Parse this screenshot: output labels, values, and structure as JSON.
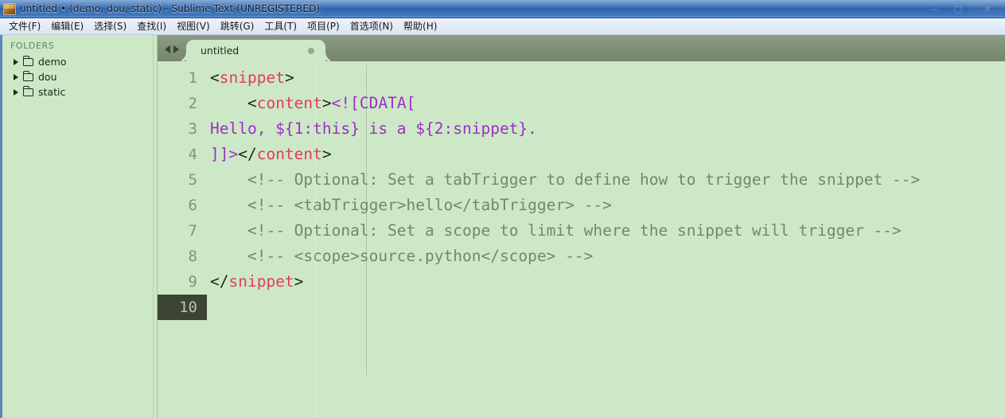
{
  "window": {
    "title": "untitled • (demo, dou, static) - Sublime Text (UNREGISTERED)",
    "icon": "sublime-text-icon",
    "controls": {
      "minimize": "—",
      "maximize": "▢",
      "close": "✕"
    }
  },
  "menubar": {
    "items": [
      {
        "label": "文件(F)",
        "text": "文件",
        "mnemonic": "F"
      },
      {
        "label": "编辑(E)",
        "text": "编辑",
        "mnemonic": "E"
      },
      {
        "label": "选择(S)",
        "text": "选择",
        "mnemonic": "S"
      },
      {
        "label": "查找(I)",
        "text": "查找",
        "mnemonic": "I"
      },
      {
        "label": "视图(V)",
        "text": "视图",
        "mnemonic": "V"
      },
      {
        "label": "跳转(G)",
        "text": "跳转",
        "mnemonic": "G"
      },
      {
        "label": "工具(T)",
        "text": "工具",
        "mnemonic": "T"
      },
      {
        "label": "项目(P)",
        "text": "项目",
        "mnemonic": "P"
      },
      {
        "label": "首选项(N)",
        "text": "首选项",
        "mnemonic": "N"
      },
      {
        "label": "帮助(H)",
        "text": "帮助",
        "mnemonic": "H"
      }
    ]
  },
  "sidebar": {
    "header": "FOLDERS",
    "folders": [
      {
        "name": "demo",
        "expanded": false
      },
      {
        "name": "dou",
        "expanded": false
      },
      {
        "name": "static",
        "expanded": false
      }
    ]
  },
  "tabbar": {
    "prev_icon": "chevron-left-icon",
    "next_icon": "chevron-right-icon",
    "tabs": [
      {
        "label": "untitled",
        "dirty": true,
        "active": true
      }
    ]
  },
  "editor": {
    "active_line": 10,
    "lines": [
      {
        "number": "1",
        "tokens": [
          {
            "text": "<",
            "type": "punct"
          },
          {
            "text": "snippet",
            "type": "tag"
          },
          {
            "text": ">",
            "type": "punct"
          }
        ]
      },
      {
        "number": "2",
        "tokens": [
          {
            "text": "    <",
            "type": "punct"
          },
          {
            "text": "content",
            "type": "tag"
          },
          {
            "text": ">",
            "type": "punct"
          },
          {
            "text": "<![CDATA[",
            "type": "cdata"
          }
        ]
      },
      {
        "number": "3",
        "tokens": [
          {
            "text": "Hello, ${1:this} is a ${2:snippet}.",
            "type": "content"
          }
        ]
      },
      {
        "number": "4",
        "tokens": [
          {
            "text": "]]>",
            "type": "cdata"
          },
          {
            "text": "</",
            "type": "punct"
          },
          {
            "text": "content",
            "type": "tag"
          },
          {
            "text": ">",
            "type": "punct"
          }
        ]
      },
      {
        "number": "5",
        "tokens": [
          {
            "text": "    <!-- Optional: Set a tabTrigger to define how to trigger the snippet -->",
            "type": "comment"
          }
        ]
      },
      {
        "number": "6",
        "tokens": [
          {
            "text": "    <!-- <tabTrigger>hello</tabTrigger> -->",
            "type": "comment"
          }
        ]
      },
      {
        "number": "7",
        "tokens": [
          {
            "text": "    <!-- Optional: Set a scope to limit where the snippet will trigger -->",
            "type": "comment"
          }
        ]
      },
      {
        "number": "8",
        "tokens": [
          {
            "text": "    <!-- <scope>source.python</scope> -->",
            "type": "comment"
          }
        ]
      },
      {
        "number": "9",
        "tokens": [
          {
            "text": "</",
            "type": "punct"
          },
          {
            "text": "snippet",
            "type": "tag"
          },
          {
            "text": ">",
            "type": "punct"
          }
        ]
      },
      {
        "number": "10",
        "tokens": []
      }
    ]
  },
  "colors": {
    "titlebar_blue": "#3a70b4",
    "editor_bg": "#cde8c6",
    "sidebar_bg": "#cde8c6",
    "tabbar_bg": "#7e8e77",
    "tag": "#e63a5e",
    "cdata": "#9b2fc9",
    "comment": "#6f8a6c",
    "punct": "#1b2a18",
    "gutter_text": "#7e9678",
    "active_gutter_bg": "#3c4433"
  }
}
